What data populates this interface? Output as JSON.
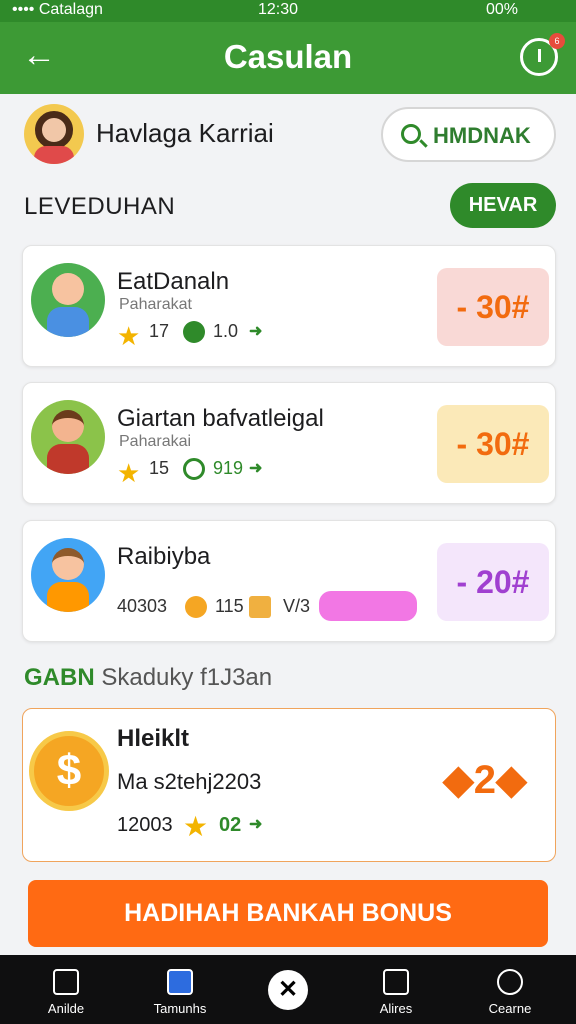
{
  "status_bar": {
    "carrier": "•••• Catalagn",
    "time": "12:30",
    "battery": "00%"
  },
  "header": {
    "title": "Casulan",
    "back_icon": "back-arrow-icon",
    "timer_icon": "timer-icon",
    "notification_count": "6"
  },
  "profile": {
    "name": "Havlaga Karriai",
    "search_label": "HMDNAK"
  },
  "leaderboard": {
    "title": "LEVEDUHAN",
    "action_label": "HEVAR",
    "items": [
      {
        "name": "EatDanaln",
        "subtitle": "Paharakat",
        "stars": "17",
        "chip_value": "1.0",
        "reward": "- 30#",
        "reward_bg": "#f9d9d6",
        "reward_fg": "#f26b0f"
      },
      {
        "name": "Giartan bafvatleigal",
        "subtitle": "Paharakai",
        "stars": "15",
        "chip_value": "919",
        "reward": "- 30#",
        "reward_bg": "#fbe9b8",
        "reward_fg": "#f26b0f"
      },
      {
        "name": "Raibiyba",
        "subtitle": "",
        "stars": "115",
        "code": "40303",
        "extra": "V/3",
        "reward": "- 20#",
        "reward_bg": "#f4e6fb",
        "reward_fg": "#a040d0"
      }
    ]
  },
  "schedule": {
    "title_green": "GABN",
    "title": "Skaduky f1J3an"
  },
  "bonus_card": {
    "title": "Hleiklt",
    "line": "Ma s2tehj2203",
    "code": "12003",
    "stars": "02",
    "value": "2"
  },
  "cta": {
    "label": "HADIHAH BANKAH BONUS"
  },
  "bottom_nav": {
    "items": [
      "Anilde",
      "Tamunhs",
      "Alires",
      "Cearne"
    ]
  },
  "colors": {
    "primary": "#3d9a35",
    "accent": "#ff6a13",
    "nav_bg": "#0f0f10"
  }
}
